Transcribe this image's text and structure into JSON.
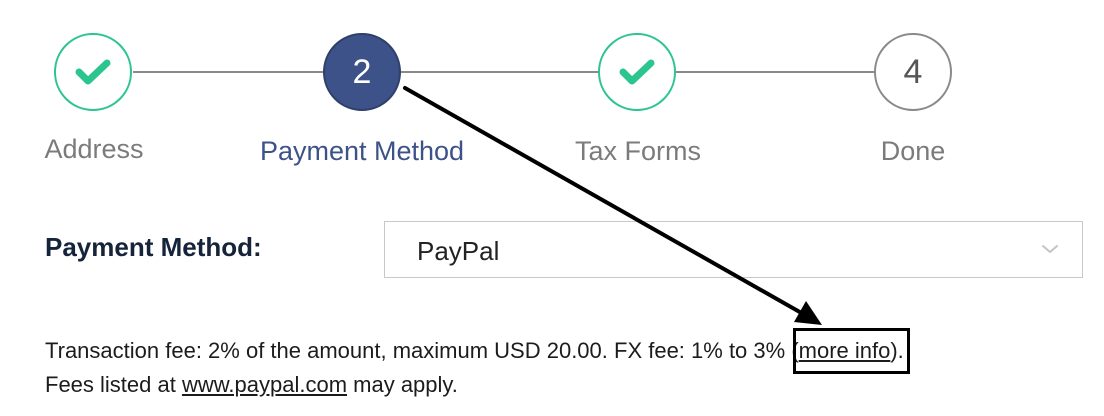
{
  "stepper": {
    "steps": [
      {
        "number": "",
        "label": "Address",
        "state": "done",
        "icon": "check-icon"
      },
      {
        "number": "2",
        "label": "Payment Method",
        "state": "active"
      },
      {
        "number": "",
        "label": "Tax Forms",
        "state": "done",
        "icon": "check-icon"
      },
      {
        "number": "4",
        "label": "Done",
        "state": "pending"
      }
    ]
  },
  "payment": {
    "label": "Payment Method:",
    "selected": "PayPal",
    "chevron_icon": "chevron-down-icon"
  },
  "fees": {
    "line1_prefix": "Transaction fee: 2% of the amount, maximum USD 20.00. FX fee: 1% to 3% (",
    "more_info": "more info",
    "line1_suffix": ").",
    "line2_prefix": "Fees listed at ",
    "paypal_link": "www.paypal.com",
    "line2_suffix": " may apply."
  },
  "colors": {
    "done_green": "#2cc58f",
    "active_navy": "#3d5288",
    "text_dark": "#15243a"
  }
}
